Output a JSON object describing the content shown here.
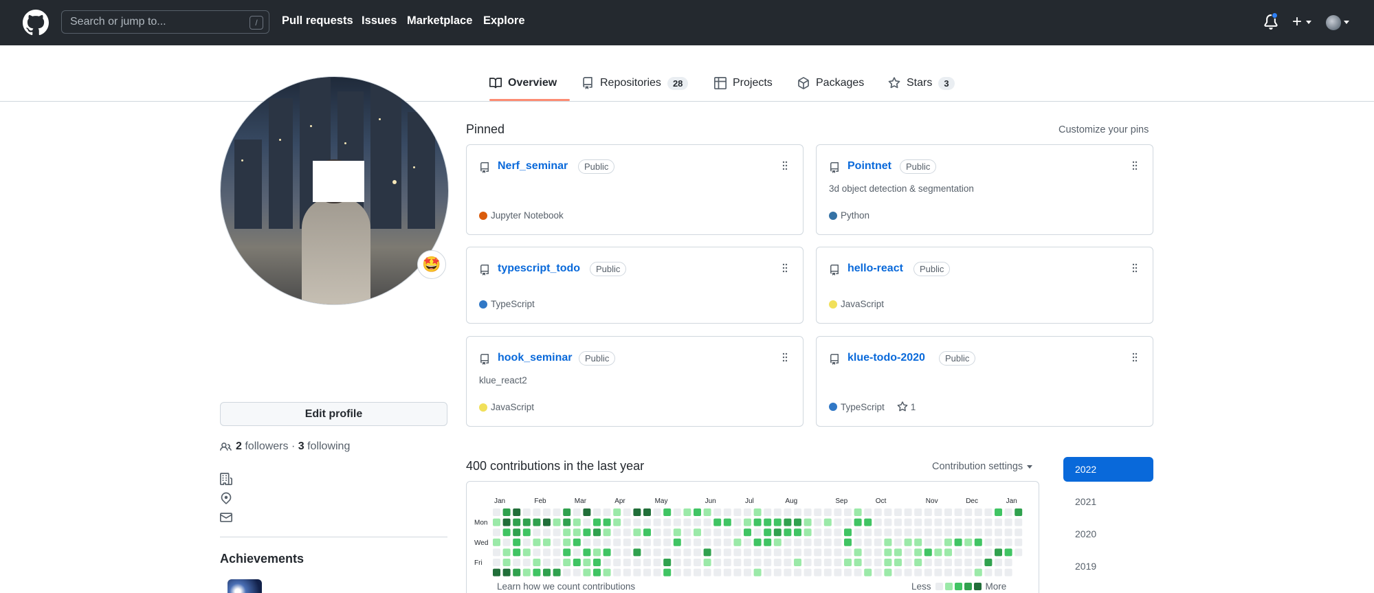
{
  "header": {
    "search_placeholder": "Search or jump to...",
    "search_key": "/",
    "nav": [
      "Pull requests",
      "Issues",
      "Marketplace",
      "Explore"
    ]
  },
  "tabs": [
    {
      "label": "Overview",
      "count": ""
    },
    {
      "label": "Repositories",
      "count": "28"
    },
    {
      "label": "Projects",
      "count": ""
    },
    {
      "label": "Packages",
      "count": ""
    },
    {
      "label": "Stars",
      "count": "3"
    }
  ],
  "profile": {
    "status_emoji": "🤩",
    "edit_label": "Edit profile",
    "followers": "2",
    "followers_label": "followers",
    "sep": "·",
    "following": "3",
    "following_label": "following",
    "achievements_title": "Achievements"
  },
  "pinned": {
    "title": "Pinned",
    "customize": "Customize your pins",
    "public_label": "Public",
    "repos": [
      {
        "name": "Nerf_seminar",
        "desc": "",
        "lang": "Jupyter Notebook",
        "color": "#DA5B0B",
        "stars": ""
      },
      {
        "name": "Pointnet",
        "desc": "3d object detection & segmentation",
        "lang": "Python",
        "color": "#3572A5",
        "stars": ""
      },
      {
        "name": "typescript_todo",
        "desc": "",
        "lang": "TypeScript",
        "color": "#3178C6",
        "stars": ""
      },
      {
        "name": "hello-react",
        "desc": "",
        "lang": "JavaScript",
        "color": "#F1E05A",
        "stars": ""
      },
      {
        "name": "hook_seminar",
        "desc": "klue_react2",
        "lang": "JavaScript",
        "color": "#F1E05A",
        "stars": ""
      },
      {
        "name": "klue-todo-2020",
        "desc": "",
        "lang": "TypeScript",
        "color": "#3178C6",
        "stars": "1"
      }
    ]
  },
  "contributions": {
    "title": "400 contributions in the last year",
    "settings_label": "Contribution settings",
    "months": [
      "Jan",
      "Feb",
      "Mar",
      "Apr",
      "May",
      "Jun",
      "Jul",
      "Aug",
      "Sep",
      "Oct",
      "Nov",
      "Dec",
      "Jan"
    ],
    "days": [
      "Mon",
      "Wed",
      "Fri"
    ],
    "learn": "Learn how we count contributions",
    "less": "Less",
    "more": "More",
    "level_colors": [
      "#ebedf0",
      "#9be9a8",
      "#40c463",
      "#30a14e",
      "#216e39"
    ]
  },
  "years": [
    "2022",
    "2021",
    "2020",
    "2019"
  ]
}
